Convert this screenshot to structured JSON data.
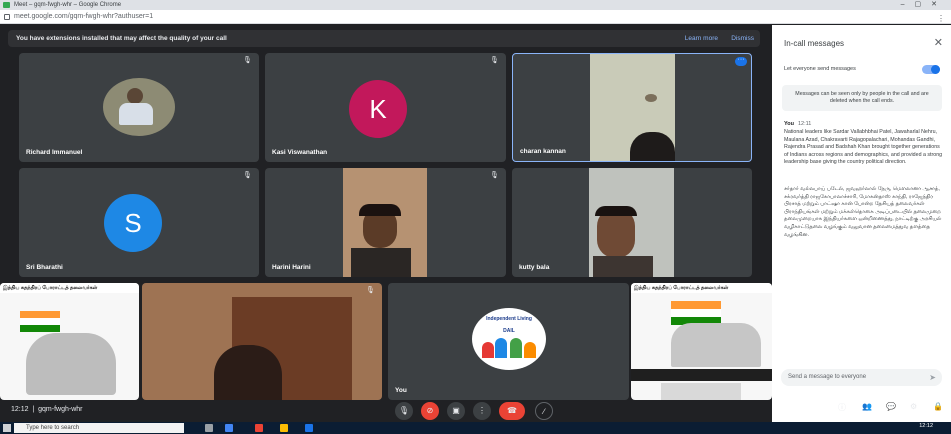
{
  "browser": {
    "tab_title": "Meet – gqm-fwgh-whr – Google Chrome",
    "url": "meet.google.com/gqm-fwgh-whr?authuser=1"
  },
  "banner": {
    "text": "You have extensions installed that may affect the quality of your call",
    "learn_more": "Learn more",
    "dismiss": "Dismiss"
  },
  "participants": [
    {
      "name": "Richard Immanuel"
    },
    {
      "name": "Kasi Viswanathan",
      "initial": "K",
      "color": "#c2185b"
    },
    {
      "name": "charan kannan"
    },
    {
      "name": "Sri Bharathi",
      "initial": "S",
      "color": "#1e88e5"
    },
    {
      "name": "Harini Harini"
    },
    {
      "name": "kutty bala"
    },
    {
      "name": "You"
    }
  ],
  "poster": {
    "title": "இந்திய சுதந்திரப் போராட்டத் தலைவர்கள்"
  },
  "logo": {
    "text": "Independent Living",
    "sub": "DAIL"
  },
  "meeting": {
    "time": "12:12",
    "code": "gqm-fwgh-whr"
  },
  "chat": {
    "title": "In-call messages",
    "toggle_label": "Let everyone send messages",
    "toggle_on": true,
    "notice": "Messages can be seen only by people in the call and are deleted when the call ends.",
    "sender": "You",
    "time": "12:11",
    "message_en": "National leaders like Sardar Vallabhbhai Patel, Jawaharlal Nehru, Maulana Azad, Chakravarti Rajagopalachari, Mohandas Gandhi, Rajendra Prasad and Badshah Khan brought together generations of Indians across regions and demographics, and provided a strong leadership base giving the country political direction.",
    "message_ta": "சர்தார் வல்லபாய் படேல், ஜவஹர்லால் நேரு, மௌலானா ஆசாத், சக்ரவர்த்தி ராஜகோபாலாச்சாரி, மோகன்தாஸ் காந்தி, ராஜேந்திர பிரசாத் மற்றும் பாட்ஷா கான் போன்ற தேசியத் தலைவர்கள் பிராந்தியங்கள் மற்றும் மக்கள்தொகை அடிப்படையில் தலைமுறை தலைமுறையாக இந்தியர்களை ஒன்றிணைத்து, நாட்டிற்கு அரசியல் வழிகாட்டுதலை வழங்கும் வலுவான தலைமைத்துவ தளத்தை வழங்கின.",
    "input_placeholder": "Send a message to everyone"
  },
  "taskbar": {
    "search_placeholder": "Type here to search",
    "time": "12:12"
  }
}
